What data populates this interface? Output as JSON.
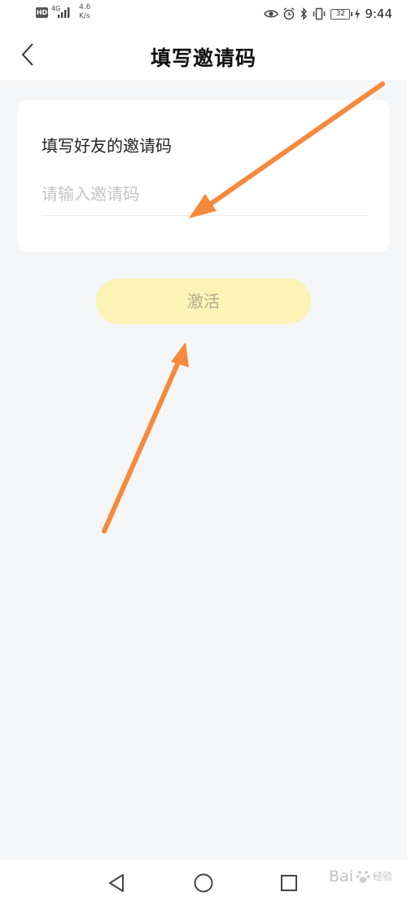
{
  "status_bar": {
    "hd_badge": "HD",
    "network_type": "4G",
    "net_speed": "4.6 K/s",
    "battery_level": "32",
    "time": "9:44",
    "icons": [
      "hd-icon",
      "signal-icon",
      "eye-icon",
      "alarm-icon",
      "bluetooth-icon",
      "vibrate-icon",
      "battery-icon",
      "charging-icon"
    ]
  },
  "header": {
    "title": "填写邀请码",
    "back_icon": "chevron-left-icon"
  },
  "card": {
    "label": "填写好友的邀请码",
    "input_placeholder": "请输入邀请码",
    "input_value": ""
  },
  "activate_button": {
    "label": "激活",
    "background_color": "#fdf3b6",
    "text_color": "#b3ab8f"
  },
  "annotation": {
    "arrow_color": "#f58a3c"
  },
  "nav_bar": {
    "icons": [
      "nav-back-icon",
      "nav-home-icon",
      "nav-recent-icon"
    ]
  },
  "watermark": {
    "text": "Bai",
    "sub_text": "经验"
  }
}
